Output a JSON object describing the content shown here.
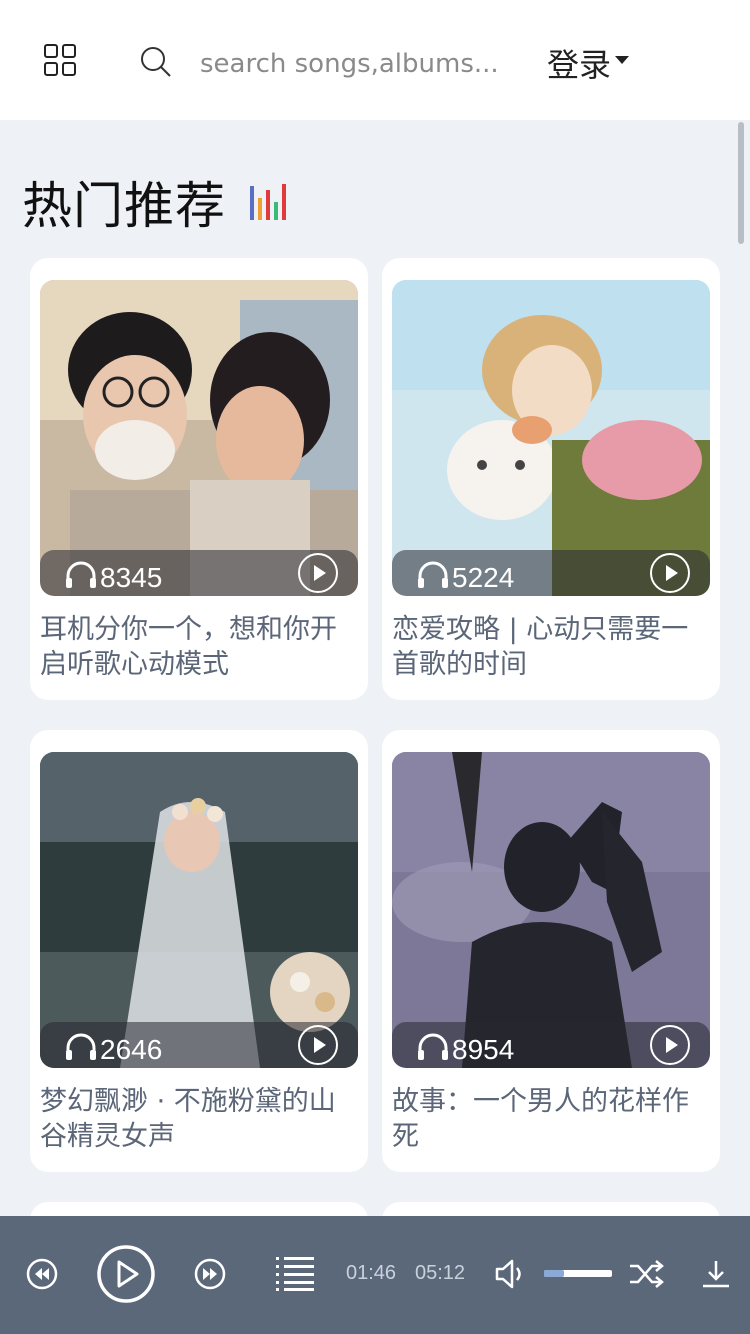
{
  "header": {
    "search_placeholder": "search songs,albums...",
    "login_label": "登录",
    "menu_icon": "grid-menu-icon",
    "search_icon": "search-icon"
  },
  "section": {
    "title": "热门推荐",
    "icon": "bar-chart-icon"
  },
  "playlists": [
    {
      "plays": "8345",
      "title": "耳机分你一个，想和你开启听歌心动模式"
    },
    {
      "plays": "5224",
      "title": "恋爱攻略 | 心动只需要一首歌的时间"
    },
    {
      "plays": "2646",
      "title": "梦幻飘渺 · 不施粉黛的山谷精灵女声"
    },
    {
      "plays": "8954",
      "title": "故事：一个男人的花样作死"
    }
  ],
  "player": {
    "current_time": "01:46",
    "total_time": "05:12",
    "volume": 0.3
  },
  "colors": {
    "player_bg": "#5b687a",
    "page_bg": "#eef1f5",
    "caption": "#5b6678",
    "volume_fill": "#8aa9d6"
  }
}
